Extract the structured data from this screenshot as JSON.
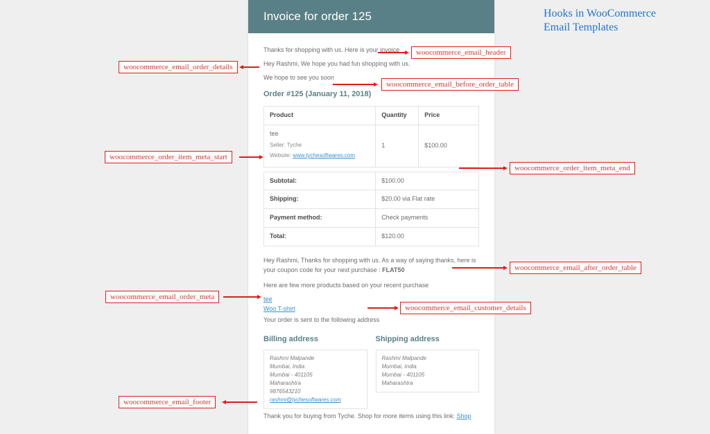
{
  "page_title": "Hooks in WooCommerce\nEmail Templates",
  "email": {
    "header_title": "Invoice for order 125",
    "intro_line": "Thanks for shopping with us. Here is your invoice",
    "greeting_line": "Hey Rashmi, We hope you had fun shopping with us.",
    "hope_line": "We hope to see you soon",
    "order_heading": "Order #125 (January 11, 2018)",
    "table": {
      "col_product": "Product",
      "col_quantity": "Quantity",
      "col_price": "Price",
      "item_name": "tee",
      "item_seller_label": "Seller: Tyche",
      "item_website_label": "Website: ",
      "item_website_link": "www.tychesoftwares.com",
      "item_qty": "1",
      "item_price": "$100.00"
    },
    "totals": {
      "subtotal_label": "Subtotal:",
      "subtotal_value": "$100.00",
      "shipping_label": "Shipping:",
      "shipping_value": "$20.00 via Flat rate",
      "payment_label": "Payment method:",
      "payment_value": "Check payments",
      "total_label": "Total:",
      "total_value": "$120.00"
    },
    "after_table_text": "Hey Rashmi, Thanks for shopping with us. As a way of saying thanks, here is your coupon code for your next purchase : ",
    "coupon_code": "FLAT50",
    "meta_intro": "Here are few more products based on your recent purchase",
    "meta_link1": "tee",
    "meta_link2": "Woo T-shirt",
    "customer_details_line": "Your order is sent to the following address",
    "billing_title": "Billing address",
    "shipping_title": "Shipping address",
    "billing": {
      "l1": "Rashmi Malpande",
      "l2": "Mumbai, India",
      "l3": "Mumbai - 401105",
      "l4": "Maharashtra",
      "l5": "9876543210",
      "l6": "rashmi@tychesoftwares.com"
    },
    "shipping": {
      "l1": "Rashmi Malpande",
      "l2": "Mumbai, India",
      "l3": "Mumbai - 401105",
      "l4": "Maharashtra"
    },
    "footer_text": "Thank you for buying from Tyche. Shop for more items using this link: ",
    "footer_link": "Shop"
  },
  "hooks": {
    "header": "woocommerce_email_header",
    "order_details": "woocommerce_email_order_details",
    "before_table": "woocommerce_email_before_order_table",
    "item_meta_start": "woocommerce_order_item_meta_start",
    "item_meta_end": "woocommerce_order_item_meta_end",
    "after_table": "woocommerce_email_after_order_table",
    "order_meta": "woocommerce_email_order_meta",
    "customer_details": "woocommerce_email_customer_details",
    "footer": "woocommerce_email_footer"
  }
}
